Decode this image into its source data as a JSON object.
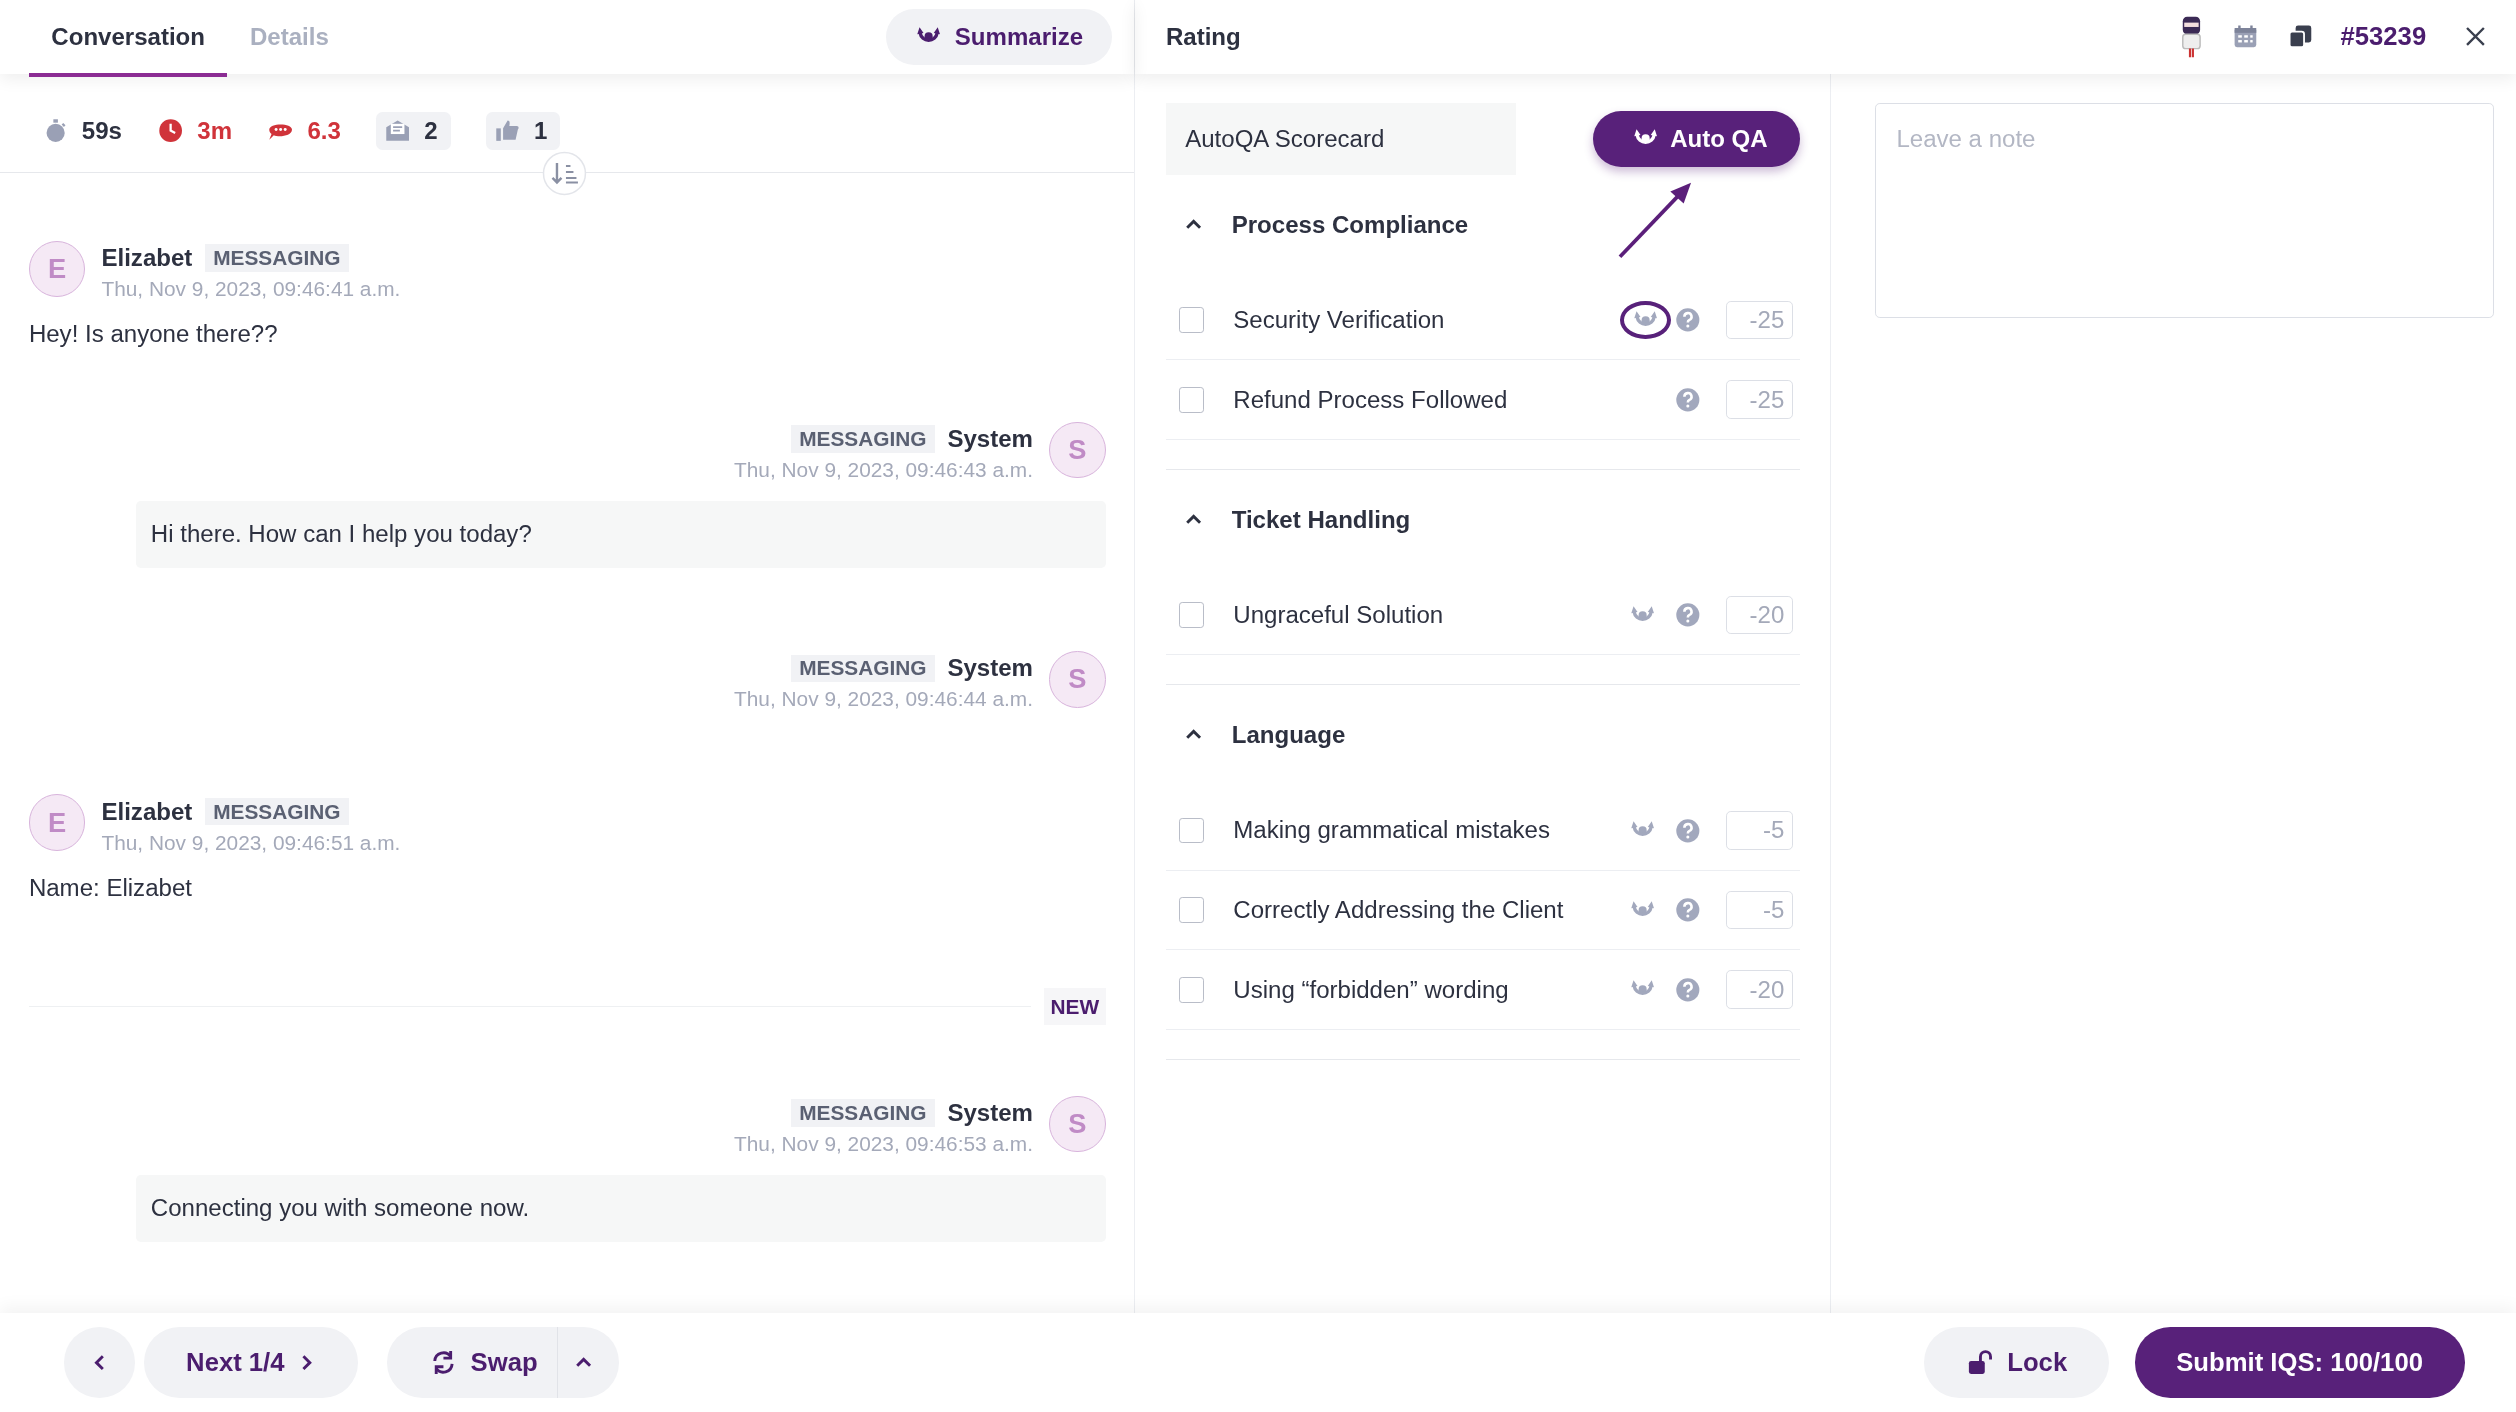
{
  "conversation": {
    "tabs": [
      {
        "label": "Conversation",
        "selected": true
      },
      {
        "label": "Details",
        "selected": false
      }
    ],
    "summarize_button": "Summarize",
    "stats": [
      {
        "kind": "timer",
        "value": "59s",
        "alert": false
      },
      {
        "kind": "clock",
        "value": "3m",
        "alert": true
      },
      {
        "kind": "chat",
        "value": "6.3",
        "alert": true
      },
      {
        "kind": "mail",
        "value": "2",
        "alert": false
      },
      {
        "kind": "thumb",
        "value": "1",
        "alert": false
      }
    ],
    "messages": [
      {
        "kind": "customer",
        "initial": "E",
        "author": "Elizabet",
        "channel": "MESSAGING",
        "time": "Thu, Nov 9, 2023, 09:46:41 a.m.",
        "text": "Hey! Is anyone there??"
      },
      {
        "kind": "system",
        "initial": "S",
        "author": "System",
        "channel": "MESSAGING",
        "time": "Thu, Nov 9, 2023, 09:46:43 a.m.",
        "text": "Hi there. How can I help you today?"
      },
      {
        "kind": "system",
        "initial": "S",
        "author": "System",
        "channel": "MESSAGING",
        "time": "Thu, Nov 9, 2023, 09:46:44 a.m."
      },
      {
        "kind": "customer",
        "initial": "E",
        "author": "Elizabet",
        "channel": "MESSAGING",
        "time": "Thu, Nov 9, 2023, 09:46:51 a.m.",
        "text": "Name: Elizabet"
      },
      {
        "kind": "divider",
        "label": "NEW"
      },
      {
        "kind": "system",
        "initial": "S",
        "author": "System",
        "channel": "MESSAGING",
        "time": "Thu, Nov 9, 2023, 09:46:53 a.m.",
        "text": "Connecting you with someone now."
      }
    ]
  },
  "rating": {
    "title": "Rating",
    "ticket": "#53239",
    "scorecard": {
      "name": "AutoQA Scorecard",
      "auto_qa_button": "Auto QA",
      "arrow_annotation": true,
      "sections": [
        {
          "title": "Process Compliance",
          "expanded": true,
          "criteria": [
            {
              "label": "Security Verification",
              "checked": false,
              "auto_qa": true,
              "highlighted": true,
              "score": "-25"
            },
            {
              "label": "Refund Process Followed",
              "checked": false,
              "auto_qa": false,
              "highlighted": false,
              "score": "-25"
            }
          ]
        },
        {
          "title": "Ticket Handling",
          "expanded": true,
          "criteria": [
            {
              "label": "Ungraceful Solution",
              "checked": false,
              "auto_qa": true,
              "highlighted": false,
              "score": "-20"
            }
          ]
        },
        {
          "title": "Language",
          "expanded": true,
          "criteria": [
            {
              "label": "Making grammatical mistakes",
              "checked": false,
              "auto_qa": true,
              "highlighted": false,
              "score": "-5"
            },
            {
              "label": "Correctly Addressing the Client",
              "checked": false,
              "auto_qa": true,
              "highlighted": false,
              "score": "-5"
            },
            {
              "label": "Using “forbidden” wording",
              "checked": false,
              "auto_qa": true,
              "highlighted": false,
              "score": "-20"
            }
          ]
        }
      ]
    },
    "note": {
      "placeholder": "Leave a note"
    }
  },
  "bottom_bar": {
    "next": "Next 1/4",
    "swap": "Swap",
    "lock": "Lock",
    "submit": "Submit IQS: 100/100"
  }
}
